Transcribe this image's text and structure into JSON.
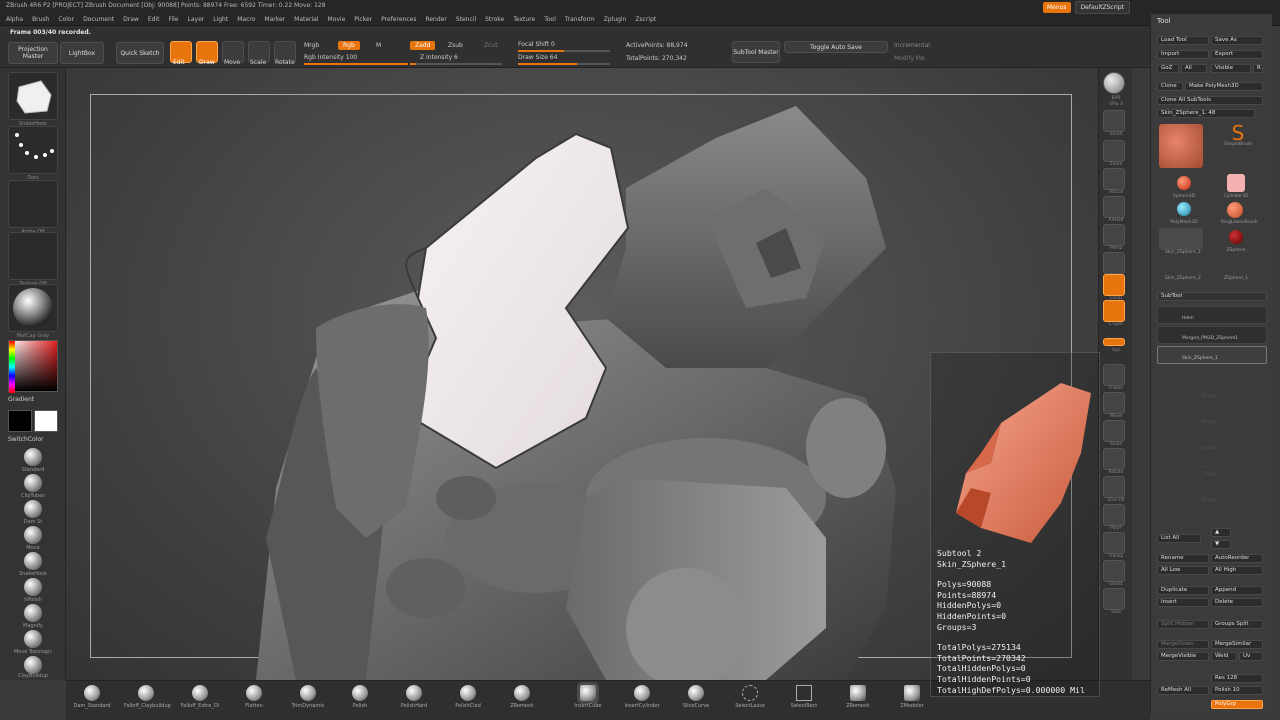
{
  "app": {
    "title": "ZBrush 4R6 P2 [PROJECT] ZBrush Document [Obj: 90088] Points: 88974 Free: 6592 Timer: 0.22 Move: 128",
    "menu": [
      "Alpha",
      "Brush",
      "Color",
      "Document",
      "Draw",
      "Edit",
      "File",
      "Layer",
      "Light",
      "Macro",
      "Marker",
      "Material",
      "Movie",
      "Picker",
      "Preferences",
      "Render",
      "Stencil",
      "Stroke",
      "Texture",
      "Tool",
      "Transform",
      "Zplugin",
      "Zscript"
    ],
    "top_buttons": {
      "menus": "Menus",
      "default_zscript": "DefaultZScript"
    }
  },
  "toolbar": {
    "status": "Frame 003/40 recorded.",
    "projection_master": "Projection Master",
    "lightbox": "LightBox",
    "quick_sketch": "Quick Sketch",
    "edit": "Edit",
    "draw": "Draw",
    "move": "Move",
    "scale": "Scale",
    "rotate": "Rotate",
    "mrgb": "Mrgb",
    "rgb": "Rgb",
    "m": "M",
    "rgb_intensity": "Rgb Intensity 100",
    "zadd": "Zadd",
    "zsub": "Zsub",
    "zcut": "Zcut",
    "z_intensity": "Z Intensity 6",
    "focal_shift": "Focal Shift 0",
    "draw_size": "Draw Size 64",
    "active_points": "ActivePoints: 88,974",
    "total_points": "TotalPoints: 270,342",
    "subtool_master": "SubTool Master",
    "toggle_auto_save": "Toggle Auto Save",
    "incremental": "Incremental",
    "modify_me": "Modify Me"
  },
  "left": {
    "brush_caption": "SnakeHook",
    "stroke_caption": "Dots",
    "alpha_caption": "Alpha Off",
    "texture_caption": "Texture Off",
    "material_caption": "MatCap Gray",
    "gradient": "Gradient",
    "switch_color": "SwitchColor",
    "brushes": [
      "Standard",
      "ClipTubes",
      "Dam St",
      "Move",
      "SnakeHook",
      "hPolish",
      "Magnify",
      "Move Topologic",
      "ClayBuildup"
    ],
    "main_color": "#e03a2a",
    "secondary_color": "#ffffff"
  },
  "right_strip": [
    "BPR",
    "SPix 3",
    "Scroll",
    "Zoom",
    "Actual",
    "AAHalf",
    "Persp",
    "Floor",
    "Local",
    "L.Sym",
    "Xyz",
    "Frame",
    "Move",
    "Scale",
    "Rotate",
    "Line Fill",
    "PolyF",
    "Transp",
    "Ghost",
    "Solo"
  ],
  "tool_panel": {
    "title": "Tool",
    "load_tool": "Load Tool",
    "save_as": "Save As",
    "import": "Import",
    "export": "Export",
    "goz": "GoZ",
    "all": "All",
    "visible": "Visible",
    "r": "R",
    "clone": "Clone",
    "make_polymesh": "Make PolyMesh3D",
    "clone_all_subtools": "Clone All SubTools",
    "current_tool": "Skin_ZSphere_1. 48",
    "tool_thumbs": [
      "SimpleBrush",
      "Sphere3D",
      "Cylinder3D",
      "PolyMesh3D",
      "RingLowerBrush",
      "Skin_ZSphere_1",
      "ZSphere",
      "Skin_ZSphere_2",
      "ZSphere_1"
    ],
    "subtool_header": "SubTool",
    "subtools": [
      "Helm",
      "Merged_PM3D_ZSphere1",
      "Skin_ZSphere_1"
    ],
    "empty_label": "Empty",
    "list_all": "List All",
    "rename": "Rename",
    "auto_reorder": "AutoReorder",
    "all_low": "All Low",
    "all_high": "All High",
    "duplicate": "Duplicate",
    "append": "Append",
    "insert": "Insert",
    "delete": "Delete",
    "split_hidden": "Split Hidden",
    "groups_split": "Groups Split",
    "merge_down": "MergeDown",
    "merge_similar": "MergeSimilar",
    "merge_visible": "MergeVisible",
    "weld": "Weld",
    "uv": "Uv",
    "remesh_all": "ReMesh All",
    "res": "Res 128",
    "polish": "Polish 10",
    "polygroups": "PolyGrp"
  },
  "bottom_shelf": [
    "Dam_Standard",
    "Falloff_Claybuildup",
    "Falloff_Extra_Dl",
    "Flatten",
    "TrimDynamic",
    "Polish",
    "PolishHard",
    "PolishClad",
    "ZRemesh",
    "InsertCube",
    "InsertCylinder",
    "SliceCurve",
    "SelectLasso",
    "SelectRect",
    "ZRemesh",
    "ZModeler"
  ],
  "info": {
    "subtool": "Subtool 2",
    "name": "Skin_ZSphere_1",
    "polys": "Polys=90088",
    "points": "Points=88974",
    "hidden_polys": "HiddenPolys=0",
    "hidden_points": "HiddenPoints=0",
    "groups": "Groups=3",
    "total_polys": "TotalPolys=275134",
    "total_points": "TotalPoints=270342",
    "total_hidden_polys": "TotalHiddenPolys=0",
    "total_hidden_points": "TotalHiddenPoints=0",
    "total_high_def": "TotalHighDefPolys=0.000000 Mil"
  },
  "colors": {
    "accent": "#e8740e",
    "subtool_orange": "#e8856a"
  }
}
